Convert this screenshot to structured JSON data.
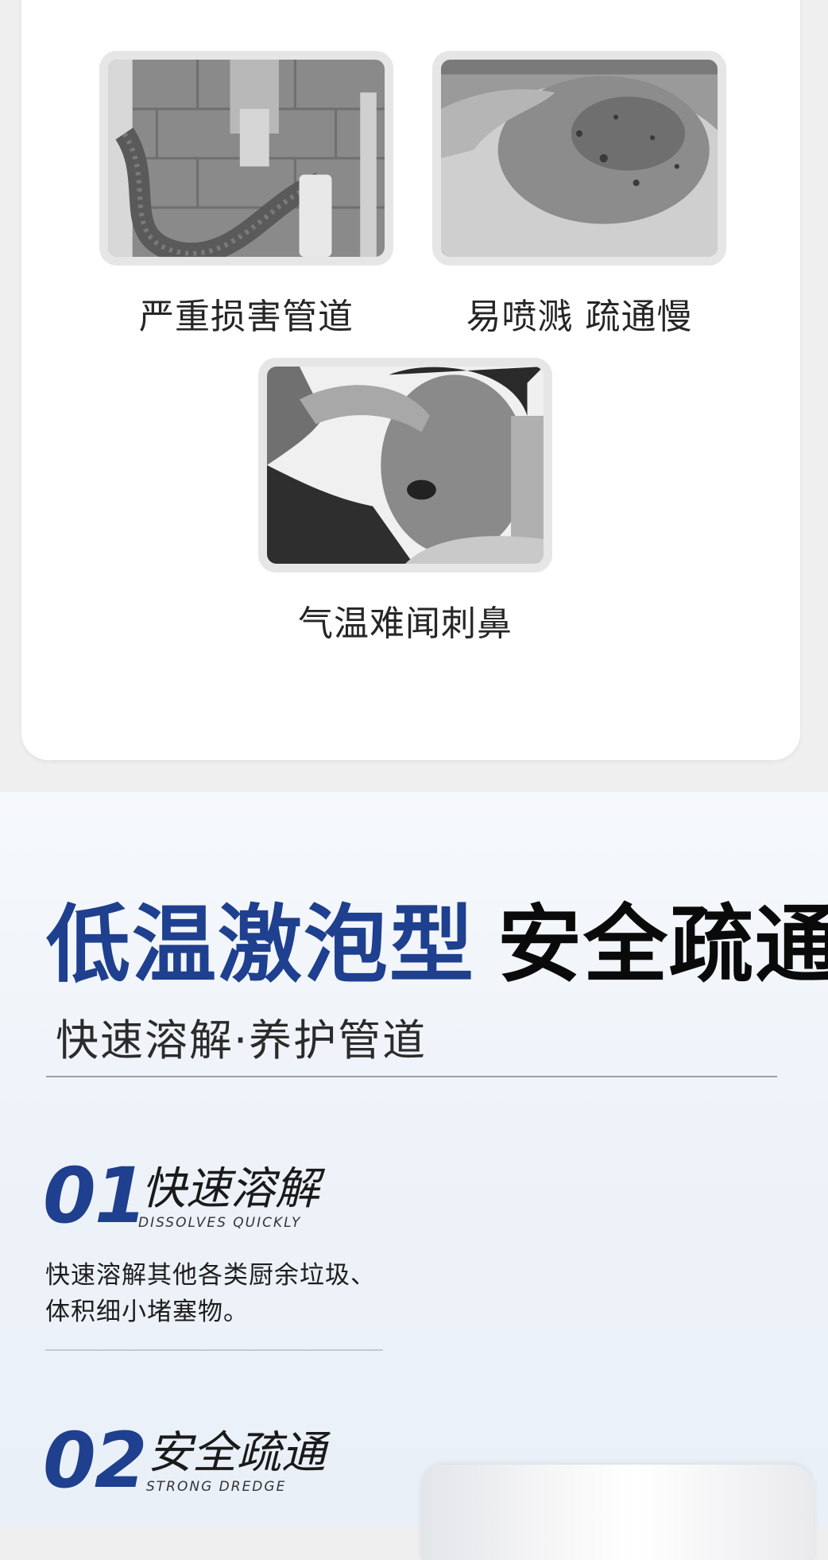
{
  "problems": [
    {
      "caption": "严重损害管道",
      "image": "pipe-damage-photo"
    },
    {
      "caption": "易喷溅 疏通慢",
      "image": "splashing-sink-photo"
    },
    {
      "caption": "气温难闻刺鼻",
      "image": "bad-smell-photo"
    }
  ],
  "hero": {
    "title_blue": "低温激泡型",
    "title_black": "安全疏通",
    "subtitle": "快速溶解·养护管道"
  },
  "features": [
    {
      "number": "01",
      "title": "快速溶解",
      "english": "DISSOLVES QUICKLY",
      "desc_line1": "快速溶解其他各类厨余垃圾、",
      "desc_line2": "体积细小堵塞物。"
    },
    {
      "number": "02",
      "title": "安全疏通",
      "english": "STRONG DREDGE"
    }
  ],
  "colors": {
    "accent_blue": "#1f3f8f",
    "card_bg": "#ffffff",
    "section_bg": "#eef3f9"
  }
}
